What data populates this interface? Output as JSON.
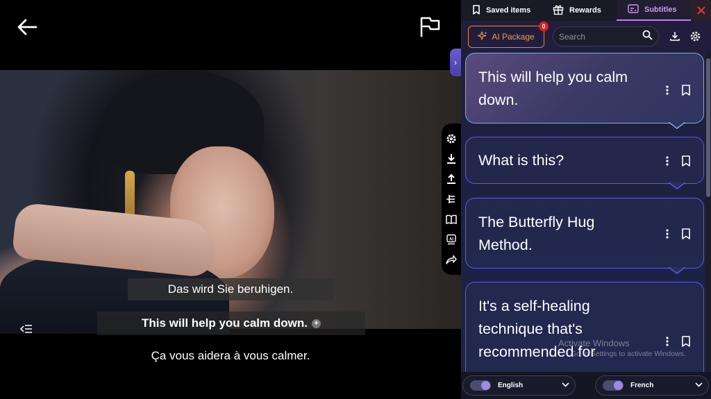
{
  "player": {
    "subtitle_secondary_top": "Das wird Sie beruhigen.",
    "subtitle_primary": "This will help you calm down.",
    "subtitle_secondary_bottom": "Ça vous aidera à vous calmer.",
    "icons": [
      "back-arrow-icon",
      "flag-icon",
      "plus-icon",
      "list-toggle-icon",
      "chevron-right-icon"
    ],
    "side_tools": [
      "gear-icon",
      "download-icon",
      "upload-icon",
      "tree-list-icon",
      "book-icon",
      "ai-chip-icon",
      "share-icon"
    ]
  },
  "panel": {
    "tabs": {
      "saved": "Saved items",
      "rewards": "Rewards",
      "subtitles": "Subtitles"
    },
    "toolbar": {
      "ai_package": "AI Package",
      "ai_badge": "0",
      "search_placeholder": "Search"
    },
    "cards": [
      {
        "text": "This will help you calm down.",
        "active": true
      },
      {
        "text": "What is this?",
        "active": false
      },
      {
        "text": "The Butterfly Hug Method.",
        "active": false
      },
      {
        "text": "It's a self-healing technique that's recommended for",
        "active": false
      }
    ],
    "watermark": {
      "title": "Activate Windows",
      "sub": "Go to Settings to activate Windows."
    },
    "languages": {
      "left": "English",
      "right": "French"
    },
    "colors": {
      "accent_purple": "#b784ef",
      "ai_orange": "#ef9a4a",
      "badge_red": "#e41c1c",
      "card_border": "#5a5ae6",
      "close_red": "#e5343c"
    }
  }
}
